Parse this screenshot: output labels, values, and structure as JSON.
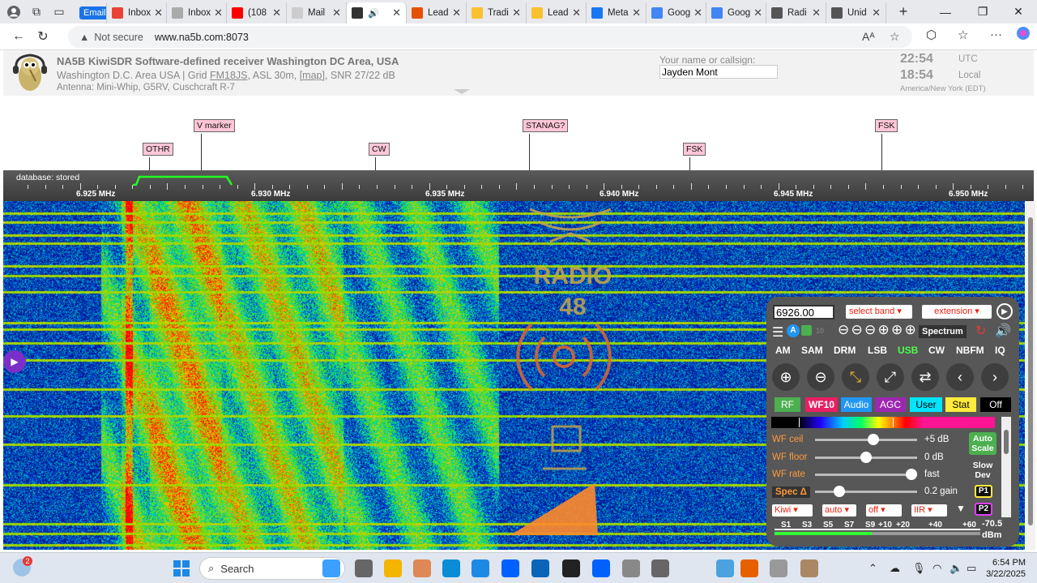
{
  "browser": {
    "tabs": [
      {
        "label": "Email",
        "color": "#1a73e8"
      },
      {
        "label": "Inbox",
        "color": "#ea4335"
      },
      {
        "label": "Inbox",
        "color": "#aaaaaa"
      },
      {
        "label": "(108",
        "color": "#ff0000"
      },
      {
        "label": "Mail",
        "color": "#cccccc"
      },
      {
        "label": "",
        "color": "#333333",
        "active": true
      },
      {
        "label": "Lead",
        "color": "#e65100"
      },
      {
        "label": "Tradi",
        "color": "#fbc02d"
      },
      {
        "label": "Lead",
        "color": "#fbc02d"
      },
      {
        "label": "Meta",
        "color": "#1877f2"
      },
      {
        "label": "Goog",
        "color": "#4285f4"
      },
      {
        "label": "Goog",
        "color": "#4285f4"
      },
      {
        "label": "Radi",
        "color": "#555555"
      },
      {
        "label": "Unid",
        "color": "#555555"
      }
    ],
    "not_secure": "Not secure",
    "url": "www.na5b.com:8073"
  },
  "kiwi": {
    "title": "NA5B KiwiSDR Software-defined receiver Washington DC Area, USA",
    "line2_a": "Washington D.C. Area USA | Grid ",
    "grid": "FM18JS",
    "line2_b": ", ASL 30m, ",
    "map": "[map]",
    "line2_c": ", SNR 27/22 dB",
    "antenna": "Antenna: Mini-Whip, G5RV, Cuschcraft R-7",
    "name_label": "Your name or callsign:",
    "name_value": "Jayden Mont",
    "utc_time": "22:54",
    "utc_label": "UTC",
    "local_time": "18:54",
    "local_label": "Local",
    "timezone": "America/New York (EDT)"
  },
  "markers": [
    {
      "label": "OTHR"
    },
    {
      "label": "V marker"
    },
    {
      "label": "CW"
    },
    {
      "label": "STANAG?"
    },
    {
      "label": "FSK"
    },
    {
      "label": "FSK"
    }
  ],
  "scale": {
    "db_label": "database: stored",
    "freqs": [
      "6.925 MHz",
      "6.930 MHz",
      "6.935 MHz",
      "6.940 MHz",
      "6.945 MHz",
      "6.950 MHz"
    ]
  },
  "panel": {
    "frequency": "6926.00",
    "select_band": "select band",
    "extension": "extension",
    "spectrum": "Spectrum",
    "modes": [
      "AM",
      "SAM",
      "DRM",
      "LSB",
      "USB",
      "CW",
      "NBFM",
      "IQ"
    ],
    "active_mode": "USB",
    "tabs": [
      "RF",
      "WF10",
      "Audio",
      "AGC",
      "User",
      "Stat",
      "Off"
    ],
    "wf_ceil_label": "WF ceil",
    "wf_ceil_value": "+5 dB",
    "wf_floor_label": "WF floor",
    "wf_floor_value": "0 dB",
    "wf_rate_label": "WF rate",
    "wf_rate_value": "fast",
    "spec_label": "Spec Δ",
    "spec_value": "0.2 gain",
    "auto_scale": "Auto Scale",
    "slow_dev": "Slow Dev",
    "p1": "P1",
    "p2": "P2",
    "dropdowns": [
      "Kiwi",
      "auto",
      "off",
      "IIR"
    ],
    "smeter_labels": [
      "S1",
      "S3",
      "S5",
      "S7",
      "S9",
      "+10",
      "+20",
      "+40",
      "+60"
    ],
    "dbm_value": "-70.5",
    "dbm_unit": "dBm",
    "zoom_step": "10"
  },
  "waterfall_text": [
    "RADIO",
    "48"
  ],
  "taskbar": {
    "search": "Search",
    "time": "6:54 PM",
    "date": "3/22/2025",
    "weather_badge": "2"
  }
}
